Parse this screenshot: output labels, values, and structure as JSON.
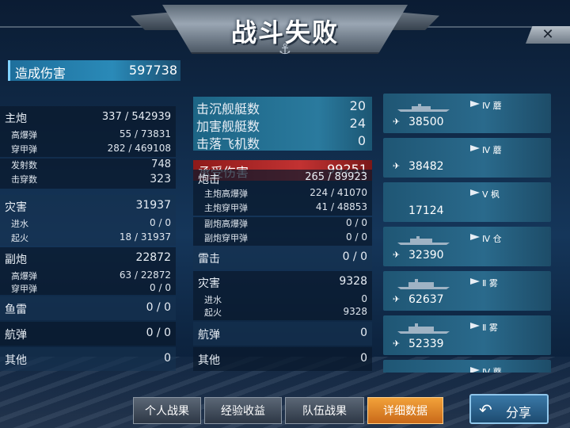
{
  "header": {
    "title": "战斗失败",
    "close_label": "✕"
  },
  "damage_dealt": {
    "label": "造成伤害",
    "value": "597738"
  },
  "dealt": {
    "main_gun": {
      "label": "主炮",
      "value": "337 / 542939",
      "rows": [
        {
          "label": "高爆弹",
          "value": "55 / 73831"
        },
        {
          "label": "穿甲弹",
          "value": "282 / 469108"
        },
        {
          "label": "发射数",
          "value": "748"
        },
        {
          "label": "击穿数",
          "value": "323"
        }
      ]
    },
    "disaster": {
      "label": "灾害",
      "value": "31937",
      "rows": [
        {
          "label": "进水",
          "value": "0 / 0"
        },
        {
          "label": "起火",
          "value": "18 / 31937"
        }
      ]
    },
    "secondary": {
      "label": "副炮",
      "value": "22872",
      "rows": [
        {
          "label": "高爆弹",
          "value": "63 / 22872"
        },
        {
          "label": "穿甲弹",
          "value": "0 / 0"
        }
      ]
    },
    "torpedo": {
      "label": "鱼雷",
      "value": "0 / 0"
    },
    "bomb": {
      "label": "航弹",
      "value": "0 / 0"
    },
    "other": {
      "label": "其他",
      "value": "0"
    }
  },
  "kills": [
    {
      "label": "击沉舰艇数",
      "value": "20"
    },
    {
      "label": "加害舰艇数",
      "value": "24"
    },
    {
      "label": "击落飞机数",
      "value": "0"
    }
  ],
  "taken": {
    "label": "承受伤害",
    "value": "99251",
    "main_gun": {
      "label": "炮击",
      "value": "265 / 89923",
      "rows": [
        {
          "label": "主炮高爆弹",
          "value": "224 / 41070"
        },
        {
          "label": "主炮穿甲弹",
          "value": "41 / 48853"
        },
        {
          "label": "副炮高爆弹",
          "value": "0 / 0"
        },
        {
          "label": "副炮穿甲弹",
          "value": "0 / 0"
        }
      ]
    },
    "torpedo": {
      "label": "雷击",
      "value": "0 / 0"
    },
    "disaster": {
      "label": "灾害",
      "value": "9328",
      "rows": [
        {
          "label": "进水",
          "value": "0"
        },
        {
          "label": "起火",
          "value": "9328"
        }
      ]
    },
    "bomb": {
      "label": "航弹",
      "value": "0"
    },
    "other": {
      "label": "其他",
      "value": "0"
    }
  },
  "ships": [
    {
      "tier": "Ⅳ 蘑",
      "damage": "38500",
      "has_silhouette": true
    },
    {
      "tier": "Ⅳ 蘑",
      "damage": "38482",
      "has_silhouette": false
    },
    {
      "tier": "Ⅴ 枫",
      "damage": "17124",
      "has_silhouette": false
    },
    {
      "tier": "Ⅳ 仓",
      "damage": "32390",
      "has_silhouette": true
    },
    {
      "tier": "Ⅱ 雾",
      "damage": "62637",
      "has_silhouette": true
    },
    {
      "tier": "Ⅱ 雾",
      "damage": "52339",
      "has_silhouette": true
    },
    {
      "tier": "Ⅳ 蘑",
      "damage": "",
      "has_silhouette": false
    }
  ],
  "tabs": [
    {
      "label": "个人战果",
      "active": false
    },
    {
      "label": "经验收益",
      "active": false
    },
    {
      "label": "队伍战果",
      "active": false
    },
    {
      "label": "详细数据",
      "active": true
    }
  ],
  "share": {
    "label": "分享",
    "icon": "back-arrow-icon"
  },
  "colors": {
    "damage_bar": "#2a8ab8",
    "kills_bar": "#2a7a9e",
    "taken_bar": "#c23232",
    "active_tab": "#f2a23a"
  }
}
